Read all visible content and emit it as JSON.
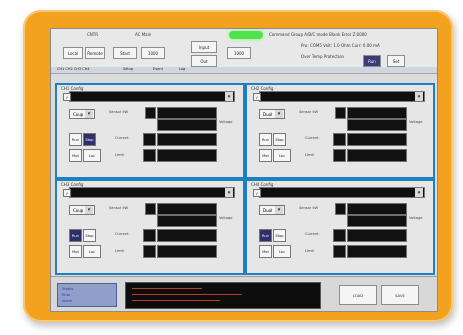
{
  "topbar": {
    "mode_label": "CNTR",
    "device_label": "AC Main",
    "status_text": "Command Group    A/B/C mode    Blank Error Z:0000",
    "line2_text": "Pro:  COM5   Volt:  1.0 Ohm   Curr: 0.00 mA",
    "line3_text": "Over Temp Protection",
    "btn_a": "Local",
    "btn_b": "Remote",
    "field_1": "Start",
    "field_2": "1000",
    "field_3": "Input",
    "field_4": "Out",
    "btn_run": "Run",
    "btn_stop": "Set"
  },
  "tabs": [
    "CH1  CH2  CH3  CH4",
    "Setup",
    "Event",
    "Log"
  ],
  "panels": [
    {
      "title": "CH1 Config",
      "mode": "Coup",
      "label_a": "Sensor kW",
      "label_b": "Voltage",
      "label_c": "Current",
      "label_d": "Limit",
      "btn_a": "Run",
      "btn_b": "Stop",
      "btn_c": "Mot",
      "btn_d": "Loc"
    },
    {
      "title": "CH2 Config",
      "mode": "Dual",
      "label_a": "Sensor kW",
      "label_b": "Voltage",
      "label_c": "Current",
      "label_d": "Limit",
      "btn_a": "Run",
      "btn_b": "Stop",
      "btn_c": "Mot",
      "btn_d": "Loc"
    },
    {
      "title": "CH3 Config",
      "mode": "Coup",
      "label_a": "Sensor kW",
      "label_b": "Voltage",
      "label_c": "Current",
      "label_d": "Limit",
      "btn_a": "Run",
      "btn_b": "Stop",
      "btn_c": "Mot",
      "btn_d": "Loc"
    },
    {
      "title": "CH4 Config",
      "mode": "Dual",
      "label_a": "Sensor kW",
      "label_b": "Voltage",
      "label_c": "Current",
      "label_d": "Limit",
      "btn_a": "Run",
      "btn_b": "Stop",
      "btn_c": "Mot",
      "btn_d": "Loc"
    }
  ],
  "bottom": {
    "left_line_1": "Status",
    "left_line_2": "Error",
    "left_line_3": "Alarm",
    "btn_left": "LOAD",
    "btn_right": "SAVE"
  },
  "colors": {
    "frame": "#f3a21f",
    "panel_border": "#1f7fc4",
    "led": "#4ee34a"
  }
}
